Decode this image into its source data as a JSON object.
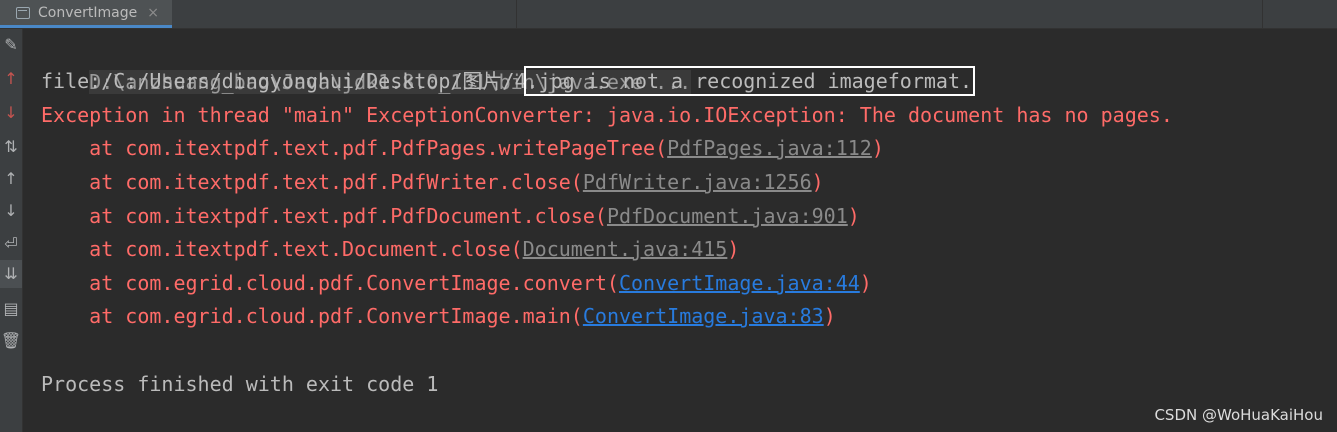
{
  "tab": {
    "title": "ConvertImage",
    "close": "×"
  },
  "gutter": [
    "edit-icon",
    "up-arrow-icon",
    "down-arrow-icon",
    "sort-icon",
    "scroll-up-icon",
    "scroll-down-icon",
    "soft-wrap-icon",
    "scroll-to-end-icon",
    "print-icon",
    "trash-icon"
  ],
  "console": {
    "cmd": "D:\\anzhuang_bao\\Java\\jdk1.8.0_131\\bin\\java.exe ...",
    "file_prefix": "file:/C:/Users/dingyonghui/Desktop/图片/4",
    "file_msg": ".jpg is not a recognized imageformat.",
    "exception": "Exception in thread \"main\" ExceptionConverter: java.io.IOException: The document has no pages.",
    "stack": [
      {
        "at": "    at com.itextpdf.text.pdf.PdfPages.writePageTree(",
        "link": "PdfPages.java:112",
        "style": "grey"
      },
      {
        "at": "    at com.itextpdf.text.pdf.PdfWriter.close(",
        "link": "PdfWriter.java:1256",
        "style": "grey"
      },
      {
        "at": "    at com.itextpdf.text.pdf.PdfDocument.close(",
        "link": "PdfDocument.java:901",
        "style": "grey"
      },
      {
        "at": "    at com.itextpdf.text.Document.close(",
        "link": "Document.java:415",
        "style": "grey"
      },
      {
        "at": "    at com.egrid.cloud.pdf.ConvertImage.convert(",
        "link": "ConvertImage.java:44",
        "style": "blue"
      },
      {
        "at": "    at com.egrid.cloud.pdf.ConvertImage.main(",
        "link": "ConvertImage.java:83",
        "style": "blue"
      }
    ],
    "close_paren": ")",
    "exit": "Process finished with exit code 1"
  },
  "watermark": "CSDN @WoHuaKaiHou"
}
